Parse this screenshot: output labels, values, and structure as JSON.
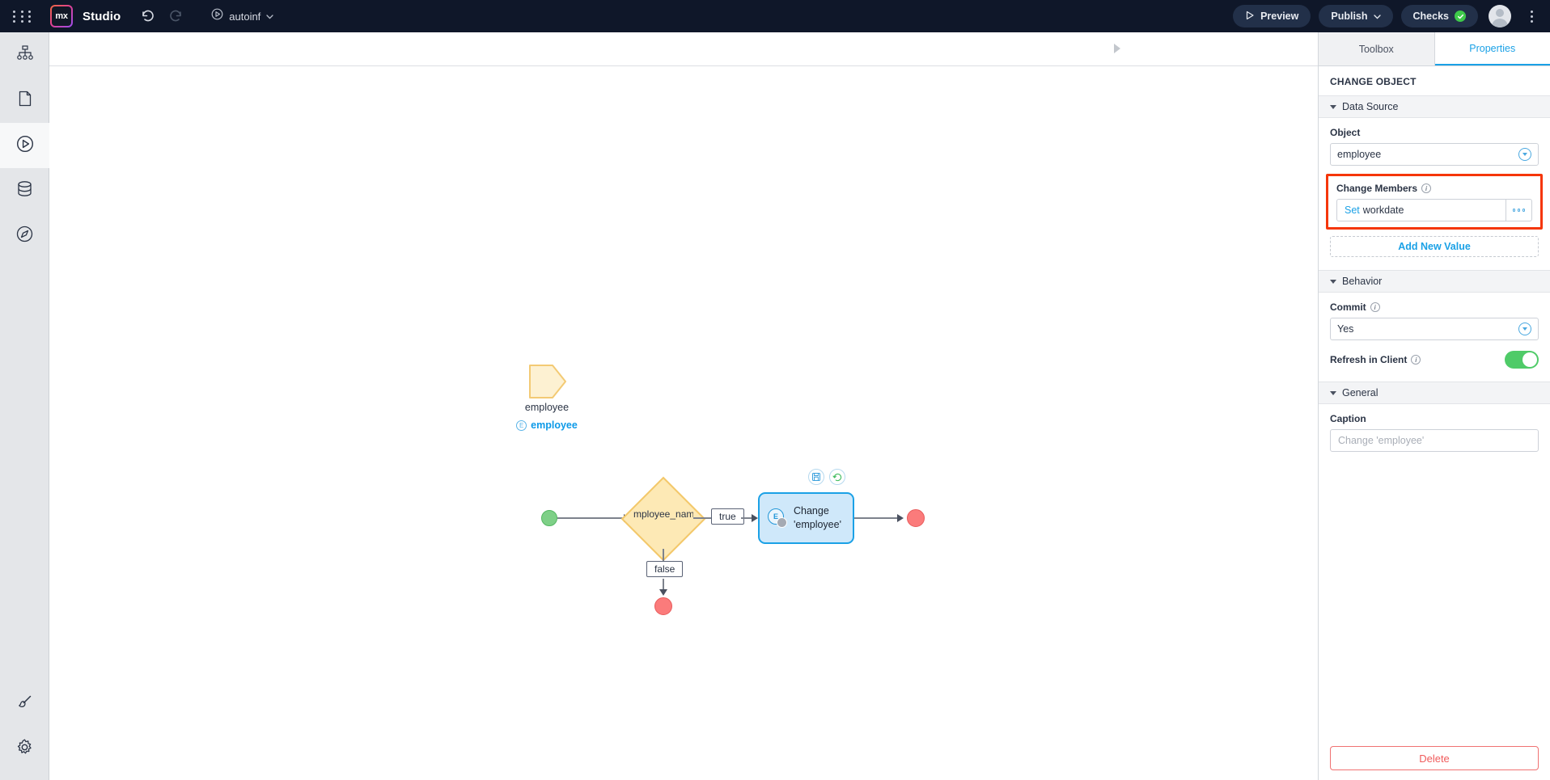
{
  "topbar": {
    "app_name": "Studio",
    "logo_text": "mx",
    "project_name": "autoinf",
    "undo_icon": "undo-icon",
    "redo_icon": "redo-icon",
    "preview_label": "Preview",
    "publish_label": "Publish",
    "checks_label": "Checks",
    "grid_icon": "app-grid-icon"
  },
  "rail": {
    "items": [
      {
        "icon": "sitemap-icon",
        "active": false
      },
      {
        "icon": "document-icon",
        "active": false
      },
      {
        "icon": "play-circle-icon",
        "active": true
      },
      {
        "icon": "database-icon",
        "active": false
      },
      {
        "icon": "compass-icon",
        "active": false
      }
    ],
    "bottom_items": [
      {
        "icon": "paintbrush-icon"
      },
      {
        "icon": "gear-icon"
      }
    ]
  },
  "flow": {
    "parameter": {
      "name": "employee",
      "entity": "employee",
      "entity_badge": "E"
    },
    "decision": {
      "text": "mployee_name"
    },
    "labels": {
      "true": "true",
      "false": "false"
    },
    "activity": {
      "line1": "Change",
      "line2": "'employee'",
      "icon_letter": "E",
      "badges": [
        "commit-badge-icon",
        "refresh-badge-icon"
      ]
    }
  },
  "panel": {
    "tabs": [
      {
        "label": "Toolbox",
        "active": false
      },
      {
        "label": "Properties",
        "active": true
      }
    ],
    "title": "CHANGE OBJECT",
    "sections": {
      "data_source": {
        "heading": "Data Source",
        "object_label": "Object",
        "object_value": "employee",
        "change_members_label": "Change Members",
        "member_set_prefix": "Set",
        "member_name": "workdate",
        "add_new_value": "Add New Value"
      },
      "behavior": {
        "heading": "Behavior",
        "commit_label": "Commit",
        "commit_value": "Yes",
        "refresh_label": "Refresh in Client",
        "refresh_on": true
      },
      "general": {
        "heading": "General",
        "caption_label": "Caption",
        "caption_placeholder": "Change 'employee'"
      }
    },
    "delete_label": "Delete"
  },
  "colors": {
    "accent_blue": "#1ba1e6",
    "highlight_red": "#f5360a",
    "toggle_green": "#4fcb68",
    "topbar_bg": "#0f1729",
    "delete_red": "#f05b5b"
  }
}
